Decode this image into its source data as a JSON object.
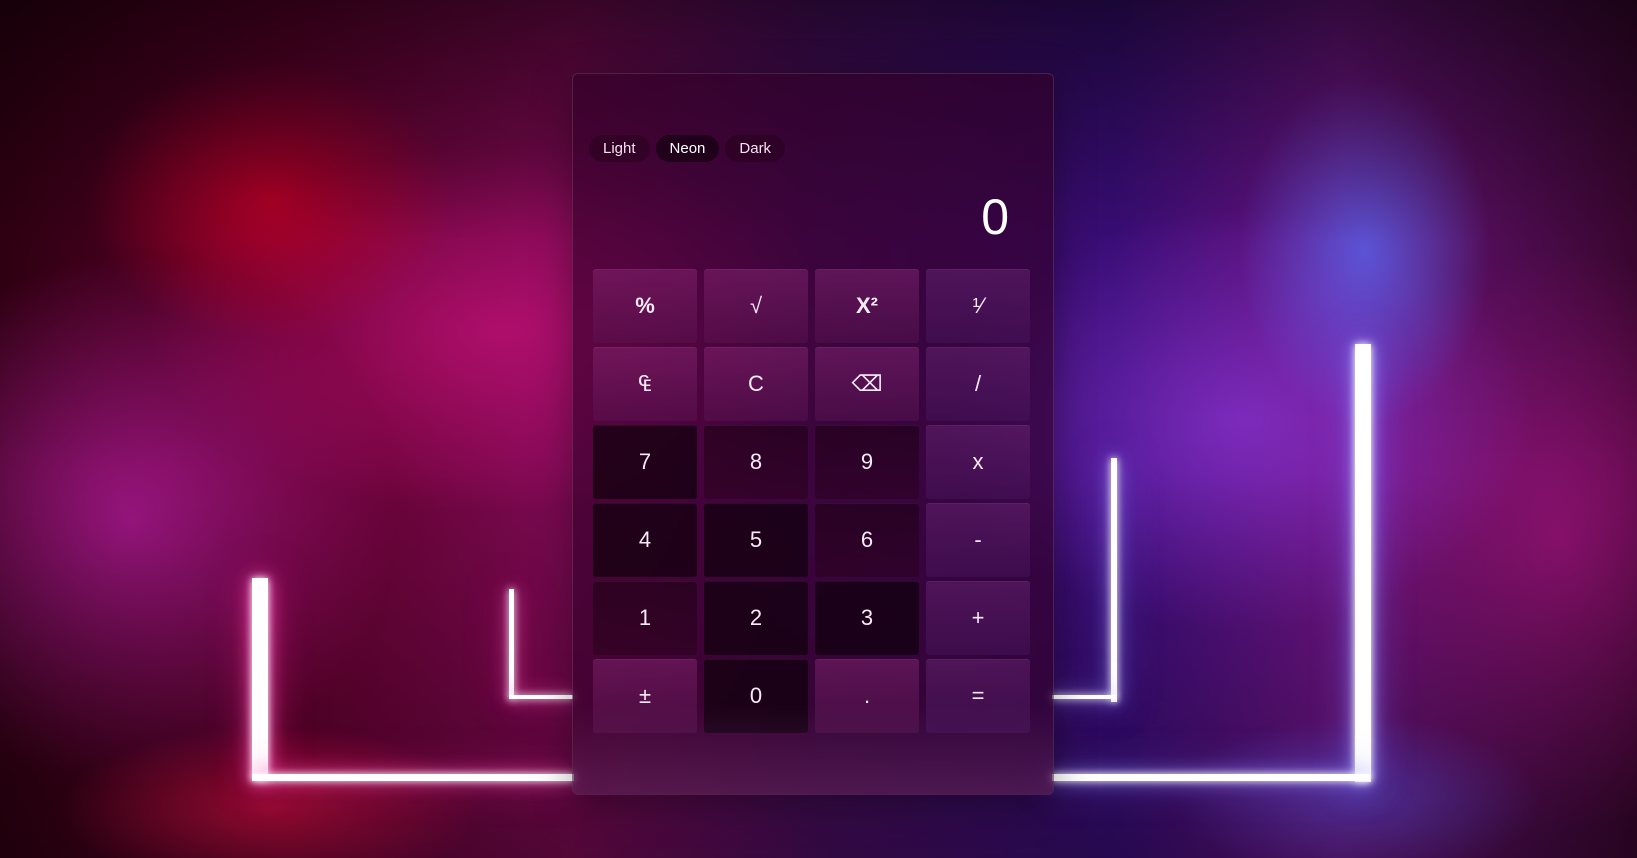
{
  "themes": [
    {
      "label": "Light",
      "active": false
    },
    {
      "label": "Neon",
      "active": true
    },
    {
      "label": "Dark",
      "active": false
    }
  ],
  "display": {
    "value": "0"
  },
  "keys": {
    "percent": "%",
    "sqrt": "√",
    "square": "X²",
    "reciprocal": "¹⁄",
    "clear_entry": "₠",
    "clear": "C",
    "backspace": "⌫",
    "divide": "/",
    "seven": "7",
    "eight": "8",
    "nine": "9",
    "multiply": "x",
    "four": "4",
    "five": "5",
    "six": "6",
    "subtract": "-",
    "one": "1",
    "two": "2",
    "three": "3",
    "add": "+",
    "negate": "±",
    "zero": "0",
    "decimal": ".",
    "equals": "="
  },
  "colors": {
    "accent": "#ff2a96",
    "panel": "#32002a",
    "text": "#ffffff"
  }
}
